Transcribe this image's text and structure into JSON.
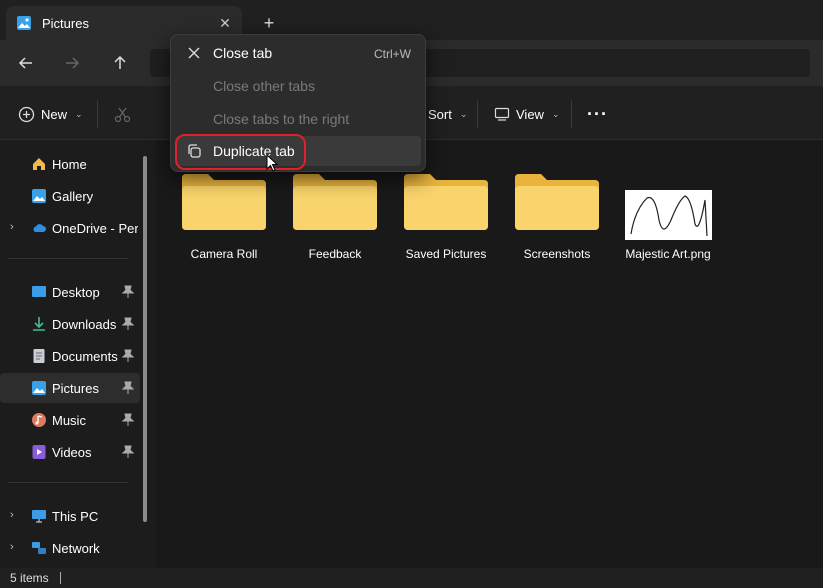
{
  "window": {
    "tab_title": "Pictures",
    "new_tab_symbol": "+",
    "close_tab_symbol": "✕"
  },
  "toolbar": {
    "new_label": "New",
    "sort_label": "Sort",
    "view_label": "View",
    "more_label": "···"
  },
  "sidebar": {
    "items": [
      {
        "label": "Home",
        "icon": "home-icon"
      },
      {
        "label": "Gallery",
        "icon": "gallery-icon"
      },
      {
        "label": "OneDrive - Perso",
        "icon": "cloud-icon",
        "expandable": true
      },
      {
        "label": "Desktop",
        "icon": "desktop-icon",
        "pinned": true
      },
      {
        "label": "Downloads",
        "icon": "download-icon",
        "pinned": true
      },
      {
        "label": "Documents",
        "icon": "documents-icon",
        "pinned": true
      },
      {
        "label": "Pictures",
        "icon": "pictures-icon",
        "pinned": true,
        "selected": true
      },
      {
        "label": "Music",
        "icon": "music-icon",
        "pinned": true
      },
      {
        "label": "Videos",
        "icon": "videos-icon",
        "pinned": true
      },
      {
        "label": "This PC",
        "icon": "pc-icon",
        "expandable": true
      },
      {
        "label": "Network",
        "icon": "network-icon",
        "expandable": true
      }
    ]
  },
  "files": [
    {
      "name": "Camera Roll",
      "type": "folder"
    },
    {
      "name": "Feedback",
      "type": "folder"
    },
    {
      "name": "Saved Pictures",
      "type": "folder"
    },
    {
      "name": "Screenshots",
      "type": "folder"
    },
    {
      "name": "Majestic Art.png",
      "type": "image"
    }
  ],
  "context_menu": {
    "items": [
      {
        "label": "Close tab",
        "shortcut": "Ctrl+W",
        "enabled": true
      },
      {
        "label": "Close other tabs",
        "enabled": false
      },
      {
        "label": "Close tabs to the right",
        "enabled": false
      },
      {
        "label": "Duplicate tab",
        "enabled": true,
        "hovered": true
      }
    ]
  },
  "status": {
    "item_count": "5 items"
  },
  "colors": {
    "accent": "#e0202a",
    "folder": "#f5c84c",
    "background": "#191919"
  }
}
